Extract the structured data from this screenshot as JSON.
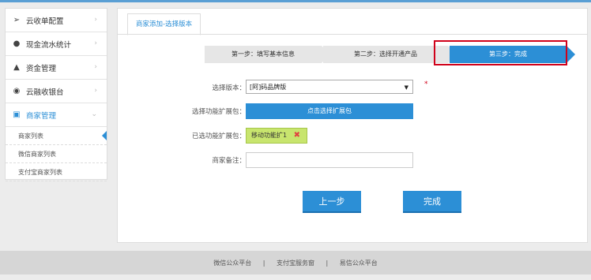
{
  "sidebar": {
    "items": [
      {
        "label": "云收单配置",
        "icon": "tag-icon"
      },
      {
        "label": "现金流水统计",
        "icon": "user-icon"
      },
      {
        "label": "资金管理",
        "icon": "money-bag-icon"
      },
      {
        "label": "云融收银台",
        "icon": "people-icon"
      },
      {
        "label": "商家管理",
        "icon": "shop-icon"
      }
    ],
    "subitems": [
      "商家列表",
      "微信商家列表",
      "支付宝商家列表"
    ]
  },
  "tab": {
    "label": "商家添加-选择版本"
  },
  "steps": [
    "第一步：填写基本信息",
    "第二步：选择开通产品",
    "第三步：完成"
  ],
  "form": {
    "version_label": "选择版本：",
    "version_value": "[阿]码品牌版",
    "required_mark": "*",
    "ext_label": "选择功能扩展包：",
    "ext_button": "点击选择扩展包",
    "selected_label": "已选功能扩展包：",
    "selected_tag": "移动功能扩1",
    "remark_label": "商家备注："
  },
  "buttons": {
    "prev": "上一步",
    "finish": "完成"
  },
  "footer": {
    "links": [
      "微信公众平台",
      "支付宝服务窗",
      "易信公众平台"
    ],
    "sep": "|"
  },
  "colors": {
    "accent": "#2c8fd6",
    "highlight_box": "#d0021b",
    "tag_bg": "#c8e56e"
  }
}
